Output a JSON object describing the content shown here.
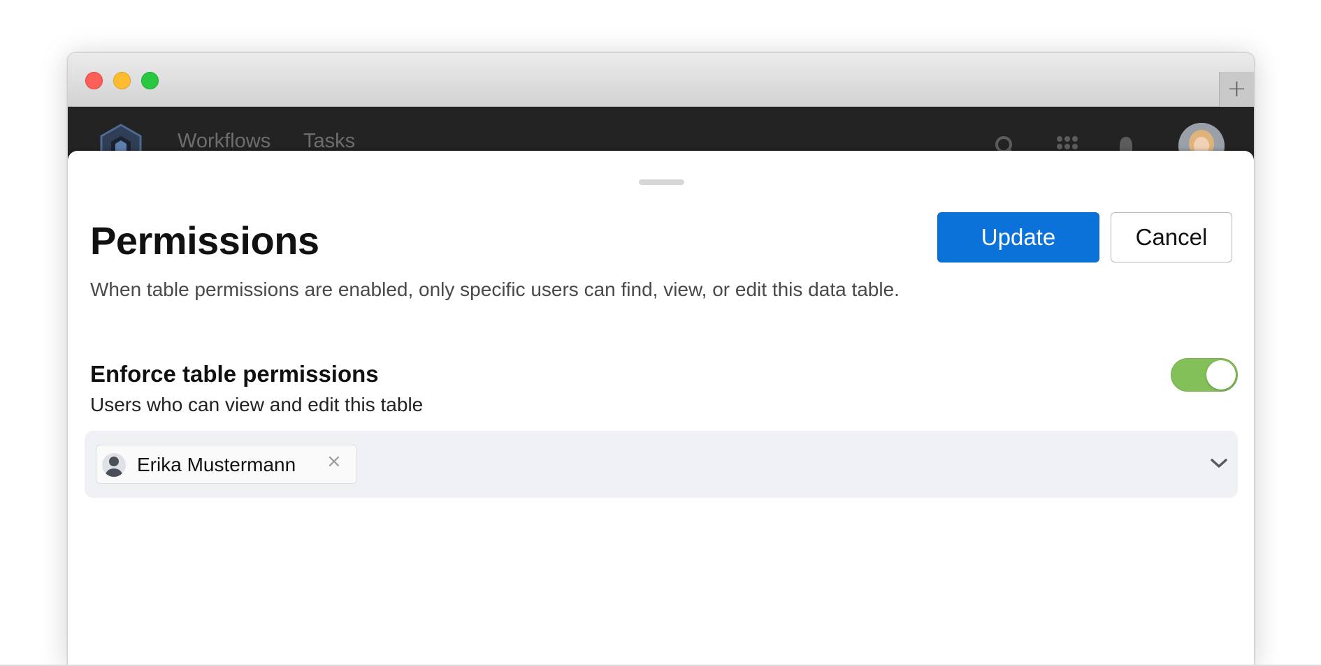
{
  "window": {
    "new_tab_icon": "plus-icon",
    "new_tab_glyph": "+"
  },
  "appbar": {
    "logo": "app-logo",
    "nav": [
      "Workflows",
      "Tasks"
    ],
    "icons": [
      "search-icon",
      "apps-grid-icon",
      "bell-icon",
      "user-avatar"
    ]
  },
  "sheet": {
    "title": "Permissions",
    "description": "When table permissions are enabled, only specific users can find, view, or edit this data table.",
    "buttons": {
      "update": "Update",
      "cancel": "Cancel"
    },
    "section": {
      "title": "Enforce table permissions",
      "subtitle": "Users who can view and edit this table",
      "toggle_on": true
    },
    "picker": {
      "selected_users": [
        {
          "name": "Erika Mustermann",
          "remove_glyph": "×"
        }
      ],
      "dropdown_icon": "chevron-down-icon"
    }
  },
  "colors": {
    "primary": "#0a72d9",
    "toggle_on": "#84c05a",
    "appbar_bg": "#232323",
    "picker_bg": "#f0f1f5"
  }
}
